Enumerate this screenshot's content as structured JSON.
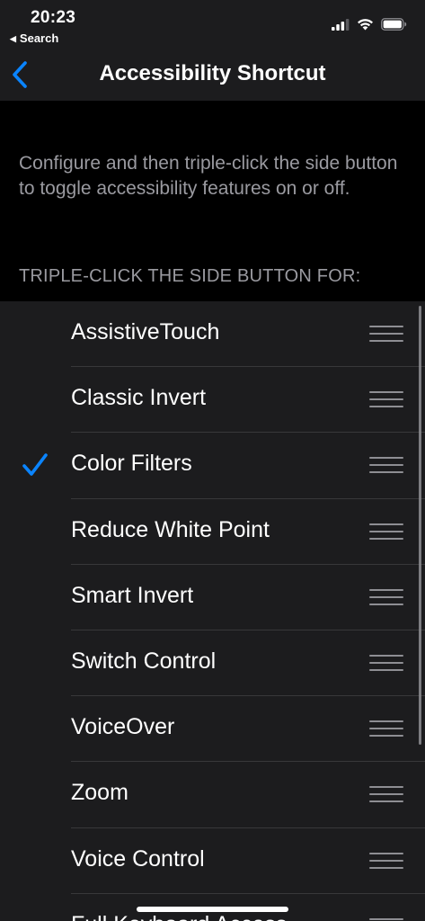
{
  "status_bar": {
    "time": "20:23",
    "back_app_label": "Search"
  },
  "nav": {
    "title": "Accessibility Shortcut"
  },
  "description": "Configure and then triple-click the side button to toggle accessibility features on or off.",
  "section_header": "TRIPLE-CLICK THE SIDE BUTTON FOR:",
  "items": [
    {
      "label": "AssistiveTouch",
      "checked": false
    },
    {
      "label": "Classic Invert",
      "checked": false
    },
    {
      "label": "Color Filters",
      "checked": true
    },
    {
      "label": "Reduce White Point",
      "checked": false
    },
    {
      "label": "Smart Invert",
      "checked": false
    },
    {
      "label": "Switch Control",
      "checked": false
    },
    {
      "label": "VoiceOver",
      "checked": false
    },
    {
      "label": "Zoom",
      "checked": false
    },
    {
      "label": "Voice Control",
      "checked": false
    },
    {
      "label": "Full Keyboard Access",
      "checked": false
    }
  ],
  "colors": {
    "accent": "#0a84ff",
    "background": "#000000",
    "cell_background": "#1c1c1e",
    "secondary_text": "#9a9aa0"
  }
}
